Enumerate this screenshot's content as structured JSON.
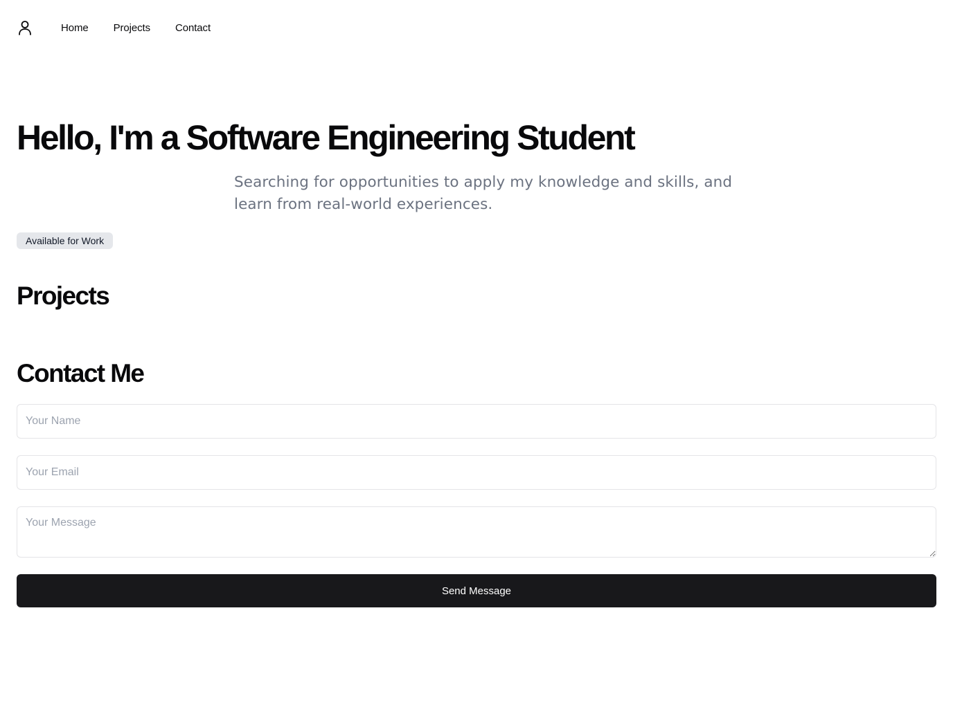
{
  "nav": {
    "icon": "user-icon",
    "links": [
      {
        "label": "Home"
      },
      {
        "label": "Projects"
      },
      {
        "label": "Contact"
      }
    ]
  },
  "hero": {
    "title": "Hello, I'm a Software Engineering Student",
    "subtitle": "Searching for opportunities to apply my knowledge and skills, and learn from real-world experiences.",
    "badge": "Available for Work"
  },
  "projects": {
    "heading": "Projects"
  },
  "contact": {
    "heading": "Contact Me",
    "name_placeholder": "Your Name",
    "email_placeholder": "Your Email",
    "message_placeholder": "Your Message",
    "submit_label": "Send Message"
  },
  "colors": {
    "text": "#09090b",
    "muted": "#6b7280",
    "badge_bg": "#e5e7eb",
    "button_bg": "#18181b",
    "border": "#e4e4e7"
  }
}
